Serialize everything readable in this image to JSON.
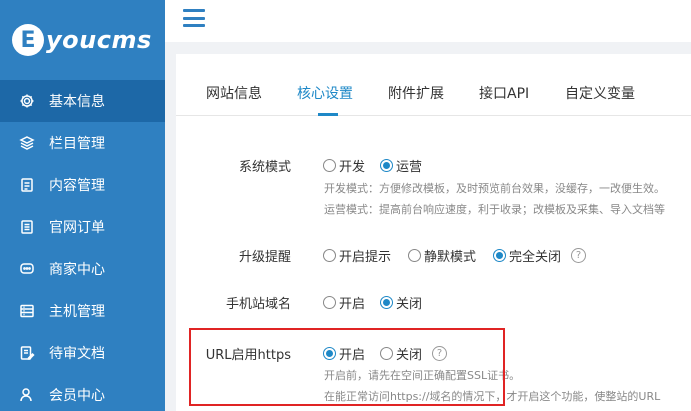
{
  "logo": {
    "mark": "E",
    "text": "youcms"
  },
  "sidebar": {
    "items": [
      {
        "label": "基本信息",
        "icon": "gear-icon",
        "active": true
      },
      {
        "label": "栏目管理",
        "icon": "layers-icon",
        "active": false
      },
      {
        "label": "内容管理",
        "icon": "document-icon",
        "active": false
      },
      {
        "label": "官网订单",
        "icon": "list-icon",
        "active": false
      },
      {
        "label": "商家中心",
        "icon": "chat-icon",
        "active": false
      },
      {
        "label": "主机管理",
        "icon": "server-icon",
        "active": false
      },
      {
        "label": "待审文档",
        "icon": "edit-icon",
        "active": false
      },
      {
        "label": "会员中心",
        "icon": "user-icon",
        "active": false
      }
    ]
  },
  "tabs": [
    {
      "label": "网站信息",
      "active": false
    },
    {
      "label": "核心设置",
      "active": true
    },
    {
      "label": "附件扩展",
      "active": false
    },
    {
      "label": "接口API",
      "active": false
    },
    {
      "label": "自定义变量",
      "active": false
    }
  ],
  "settings": {
    "system_mode": {
      "label": "系统模式",
      "options": [
        "开发",
        "运营"
      ],
      "selected": "运营",
      "hint1": "开发模式：方便修改模板，及时预览前台效果，没缓存，一改便生效。",
      "hint2": "运营模式：提高前台响应速度，利于收录；改模板及采集、导入文档等"
    },
    "upgrade": {
      "label": "升级提醒",
      "options": [
        "开启提示",
        "静默模式",
        "完全关闭"
      ],
      "selected": "完全关闭"
    },
    "mobile_domain": {
      "label": "手机站域名",
      "options": [
        "开启",
        "关闭"
      ],
      "selected": "关闭"
    },
    "https": {
      "label": "URL启用https",
      "options": [
        "开启",
        "关闭"
      ],
      "selected": "开启",
      "hint1": "开启前，请先在空间正确配置SSL证书。",
      "hint2": "在能正常访问https://域名的情况下，才开启这个功能，使整站的URL"
    }
  },
  "colors": {
    "sidebar": "#2f80c1",
    "sidebar_active": "#1d68a7",
    "accent": "#1e88c7",
    "highlight": "#e02424"
  }
}
